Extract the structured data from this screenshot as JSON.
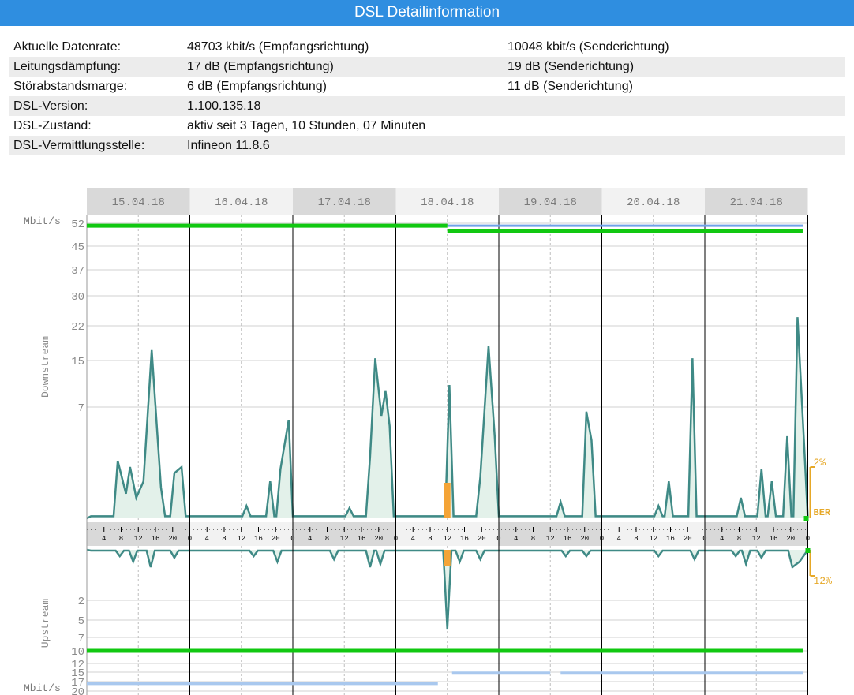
{
  "header": {
    "title": "DSL Detailinformation"
  },
  "info_rows": [
    {
      "label": "Aktuelle Datenrate:",
      "down": "48703 kbit/s (Empfangsrichtung)",
      "up": "10048 kbit/s (Senderichtung)"
    },
    {
      "label": "Leitungsdämpfung:",
      "down": "17 dB (Empfangsrichtung)",
      "up": "19 dB (Senderichtung)"
    },
    {
      "label": "Störabstandsmarge:",
      "down": "6 dB (Empfangsrichtung)",
      "up": "11 dB (Senderichtung)"
    },
    {
      "label": "DSL-Version:",
      "down": "1.100.135.18",
      "up": ""
    },
    {
      "label": "DSL-Zustand:",
      "down": "aktiv seit 3 Tagen, 10 Stunden, 07 Minuten",
      "up": ""
    },
    {
      "label": "DSL-Vermittlungsstelle:",
      "down": "Infineon 11.8.6",
      "up": ""
    }
  ],
  "chart_data": {
    "type": "line",
    "unit_label": "Mbit/s",
    "dates": [
      "15.04.18",
      "16.04.18",
      "17.04.18",
      "18.04.18",
      "19.04.18",
      "20.04.18",
      "21.04.18"
    ],
    "hour_ticks": [
      "4",
      "8",
      "12",
      "16",
      "20",
      "0"
    ],
    "downstream": {
      "label": "Downstream",
      "y_ticks": [
        52,
        45,
        37,
        30,
        22,
        15,
        7
      ],
      "max_rate_before": 51.5,
      "max_rate_after": 51.5,
      "sync_rate_before": 51.5,
      "sync_rate_after": 49.7,
      "switch_day": 3.5
    },
    "upstream": {
      "label": "Upstream",
      "y_ticks": [
        2,
        5,
        7,
        10,
        12,
        15,
        17,
        20
      ],
      "sync_rate": 10,
      "max_rate_before": 17.6,
      "max_rate_after": 15.2,
      "switch_day": 3.5
    },
    "ber": {
      "label": "BER",
      "down_scale": "2%",
      "up_scale": "12%",
      "down_peaks": [
        {
          "x": 0.3,
          "v": 0.28
        },
        {
          "x": 0.38,
          "v": 0.12
        },
        {
          "x": 0.42,
          "v": 0.25
        },
        {
          "x": 0.48,
          "v": 0.1
        },
        {
          "x": 0.55,
          "v": 0.18
        },
        {
          "x": 0.63,
          "v": 0.82
        },
        {
          "x": 0.72,
          "v": 0.15
        },
        {
          "x": 0.85,
          "v": 0.22
        },
        {
          "x": 0.92,
          "v": 0.25
        },
        {
          "x": 1.55,
          "v": 0.06
        },
        {
          "x": 1.78,
          "v": 0.18
        },
        {
          "x": 1.88,
          "v": 0.24
        },
        {
          "x": 1.96,
          "v": 0.48
        },
        {
          "x": 2.55,
          "v": 0.05
        },
        {
          "x": 2.75,
          "v": 0.3
        },
        {
          "x": 2.8,
          "v": 0.78
        },
        {
          "x": 2.86,
          "v": 0.5
        },
        {
          "x": 2.9,
          "v": 0.62
        },
        {
          "x": 2.94,
          "v": 0.45
        },
        {
          "x": 3.52,
          "v": 0.65
        },
        {
          "x": 3.82,
          "v": 0.2
        },
        {
          "x": 3.9,
          "v": 0.84
        },
        {
          "x": 3.96,
          "v": 0.4
        },
        {
          "x": 4.6,
          "v": 0.08
        },
        {
          "x": 4.85,
          "v": 0.52
        },
        {
          "x": 4.9,
          "v": 0.38
        },
        {
          "x": 5.55,
          "v": 0.06
        },
        {
          "x": 5.65,
          "v": 0.18
        },
        {
          "x": 5.88,
          "v": 0.78
        },
        {
          "x": 6.35,
          "v": 0.1
        },
        {
          "x": 6.55,
          "v": 0.24
        },
        {
          "x": 6.65,
          "v": 0.18
        },
        {
          "x": 6.8,
          "v": 0.4
        },
        {
          "x": 6.9,
          "v": 0.98
        },
        {
          "x": 6.96,
          "v": 0.4
        }
      ],
      "up_peaks": [
        {
          "x": 0.32,
          "v": 0.08
        },
        {
          "x": 0.45,
          "v": 0.15
        },
        {
          "x": 0.62,
          "v": 0.22
        },
        {
          "x": 0.85,
          "v": 0.1
        },
        {
          "x": 1.62,
          "v": 0.08
        },
        {
          "x": 1.85,
          "v": 0.15
        },
        {
          "x": 2.4,
          "v": 0.12
        },
        {
          "x": 2.75,
          "v": 0.22
        },
        {
          "x": 2.85,
          "v": 0.18
        },
        {
          "x": 3.5,
          "v": 1.0
        },
        {
          "x": 3.62,
          "v": 0.15
        },
        {
          "x": 3.82,
          "v": 0.12
        },
        {
          "x": 4.65,
          "v": 0.08
        },
        {
          "x": 4.85,
          "v": 0.08
        },
        {
          "x": 5.55,
          "v": 0.08
        },
        {
          "x": 5.9,
          "v": 0.12
        },
        {
          "x": 6.3,
          "v": 0.08
        },
        {
          "x": 6.4,
          "v": 0.18
        },
        {
          "x": 6.55,
          "v": 0.1
        },
        {
          "x": 6.85,
          "v": 0.22
        },
        {
          "x": 6.92,
          "v": 0.15
        }
      ]
    },
    "colors": {
      "sync_rate": "#11c811",
      "max_rate": "#6fa2e8",
      "upstream_max_rate": "#a9c8ee",
      "ber_line": "#3f8a86",
      "ber_fill": "#e3f1ea",
      "ber_marker": "#f4a437",
      "ber_scale": "#e6a828",
      "day_band": "#d9d9d9",
      "grid": "#b0b0b0",
      "day_divider": "#000000",
      "axis_text": "#8a8a8a"
    }
  }
}
